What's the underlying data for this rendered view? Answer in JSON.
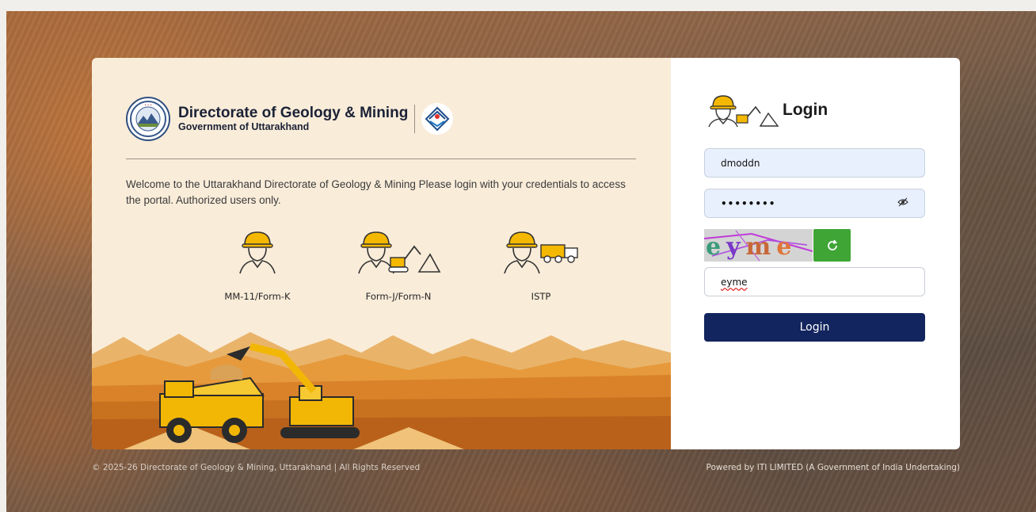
{
  "header": {
    "org_title": "Directorate of Geology & Mining",
    "org_subtitle": "Government of Uttarakhand"
  },
  "welcome_text": "Welcome to the Uttarakhand Directorate of Geology & Mining Please login with your credentials to access the portal. Authorized users only.",
  "roles": [
    {
      "label": "MM-11/Form-K",
      "icon": "miner-icon"
    },
    {
      "label": "Form-J/Form-N",
      "icon": "miner-excavator-icon"
    },
    {
      "label": "ISTP",
      "icon": "miner-truck-icon"
    }
  ],
  "login": {
    "title": "Login",
    "username_value": "dmoddn",
    "password_value": "••••••••",
    "captcha_image_text": "eyme",
    "captcha_input_value": "eyme",
    "submit_label": "Login"
  },
  "footer": {
    "copyright": "© 2025-26 Directorate of Geology & Mining, Uttarakhand | All Rights Reserved",
    "powered_by": "Powered by ITI LIMITED (A Government of India Undertaking)"
  },
  "colors": {
    "left_panel_bg": "#f9ecd9",
    "login_button": "#13255e",
    "refresh_button": "#3fa535",
    "input_autofill_bg": "#e8f0fe",
    "helmet": "#f5b800"
  }
}
